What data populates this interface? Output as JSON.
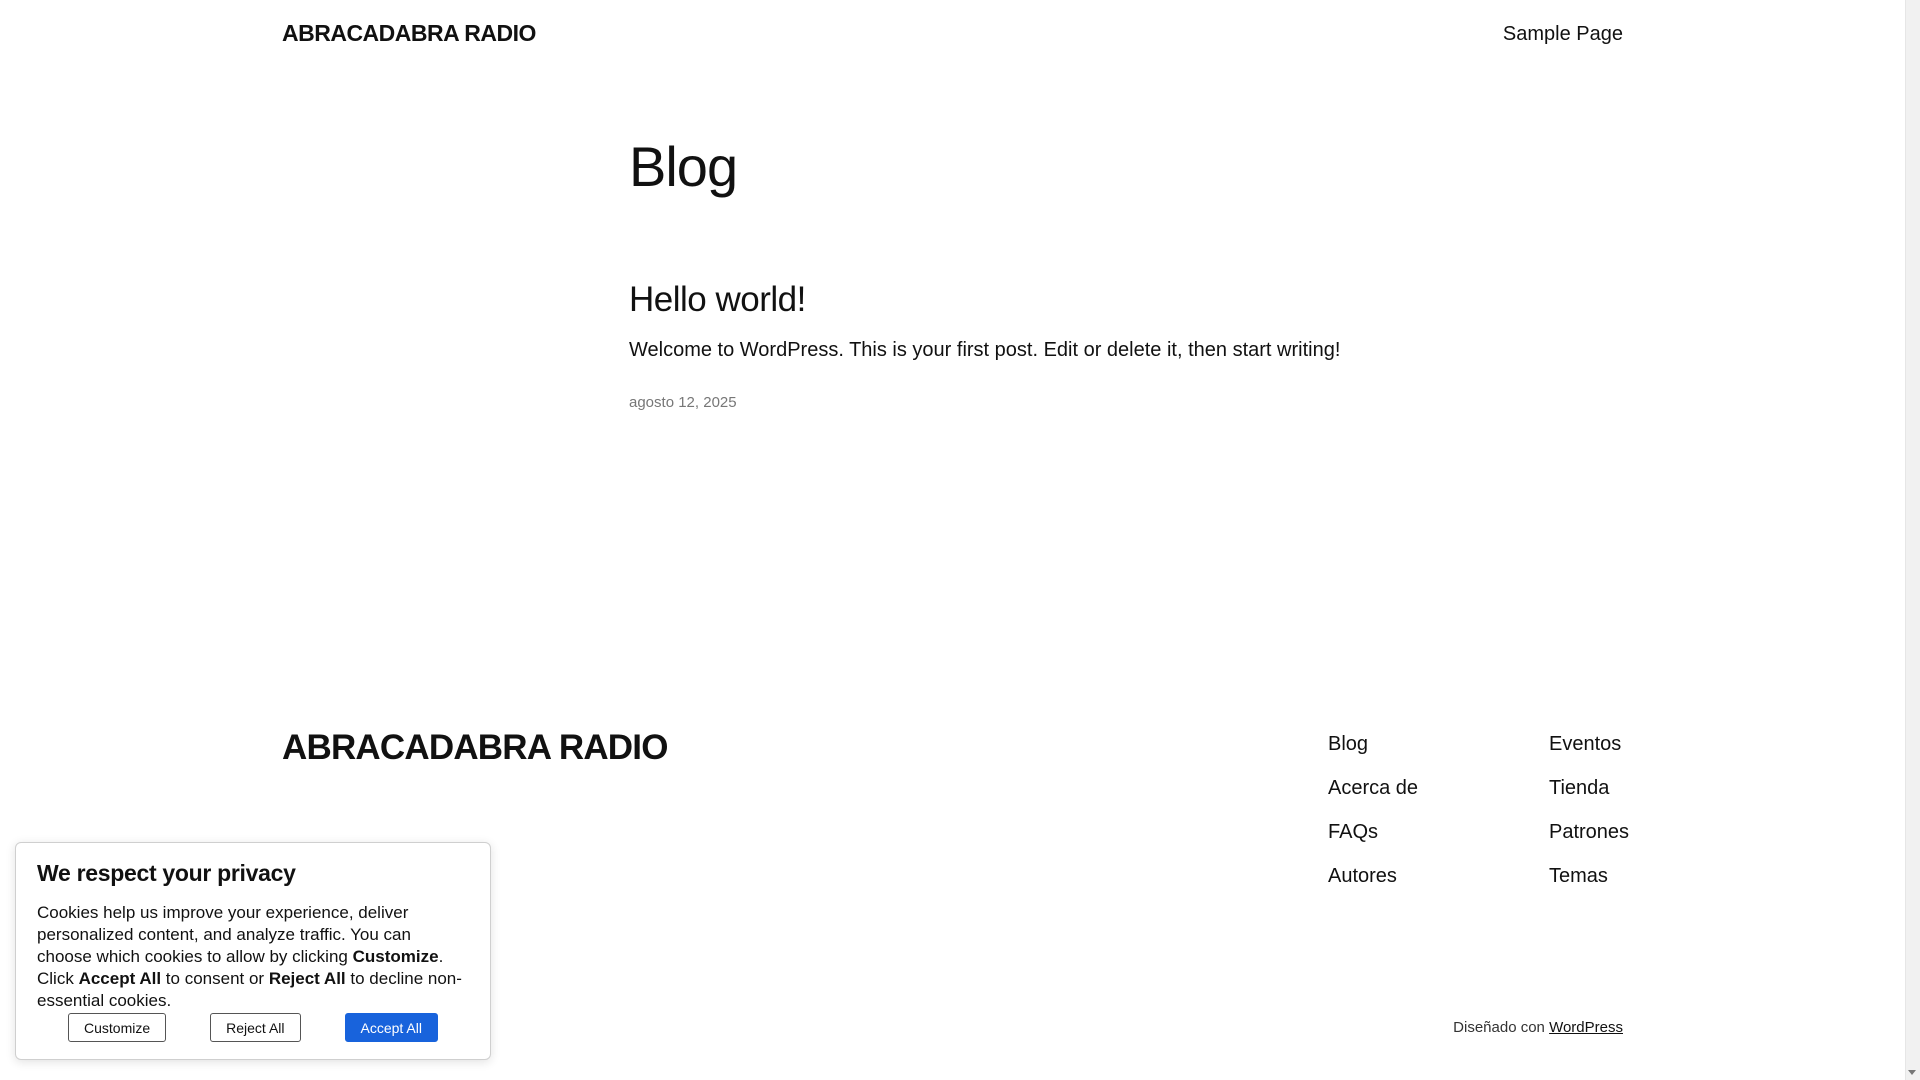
{
  "header": {
    "site_title": "ABRACADABRA RADIO",
    "nav_link": "Sample Page"
  },
  "main": {
    "heading": "Blog",
    "post": {
      "title": "Hello world!",
      "excerpt": "Welcome to WordPress. This is your first post. Edit or delete it, then start writing!",
      "date": "agosto 12, 2025"
    }
  },
  "footer": {
    "site_title": "ABRACADABRA RADIO",
    "nav_col_1": [
      "Blog",
      "Acerca de",
      "FAQs",
      "Autores"
    ],
    "nav_col_2": [
      "Eventos",
      "Tienda",
      "Patrones",
      "Temas"
    ],
    "credit_prefix": "Diseñado con",
    "credit_link": "WordPress"
  },
  "cookie_banner": {
    "title": "We respect your privacy",
    "text_1": "Cookies help us improve your experience, deliver personalized content, and analyze traffic. You can choose which cookies to allow by clicking ",
    "text_bold_1": "Customize",
    "text_2": ". Click ",
    "text_bold_2": "Accept All",
    "text_3": " to consent or ",
    "text_bold_3": "Reject All",
    "text_4": " to decline non-essential cookies.",
    "customize_label": "Customize",
    "reject_label": "Reject All",
    "accept_label": "Accept All",
    "accent_color": "#1863dc"
  }
}
